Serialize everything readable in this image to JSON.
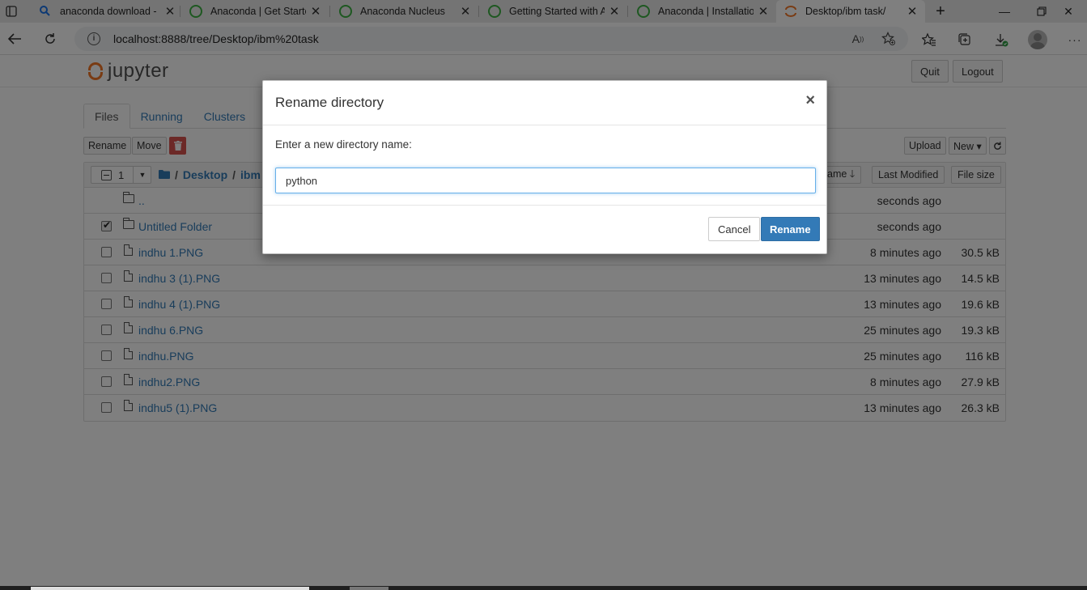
{
  "browser": {
    "tabs": [
      {
        "title": "anaconda download -",
        "icon": "search-icon"
      },
      {
        "title": "Anaconda | Get Started",
        "icon": "loading-ring-icon"
      },
      {
        "title": "Anaconda Nucleus",
        "icon": "loading-ring-icon"
      },
      {
        "title": "Getting Started with A",
        "icon": "loading-ring-icon"
      },
      {
        "title": "Anaconda | Installation",
        "icon": "loading-ring-icon"
      },
      {
        "title": "Desktop/ibm task/",
        "icon": "jupyter-icon",
        "active": true
      }
    ],
    "url": "localhost:8888/tree/Desktop/ibm%20task"
  },
  "jupyter": {
    "logo_text": "jupyter",
    "quit_label": "Quit",
    "logout_label": "Logout",
    "tabs": [
      "Files",
      "Running",
      "Clusters"
    ],
    "toolbar": {
      "rename_label": "Rename",
      "move_label": "Move",
      "upload_label": "Upload",
      "new_label": "New ▾"
    },
    "list_header": {
      "selected_count": "1",
      "breadcrumb_root": "/",
      "breadcrumb_desktop": "Desktop",
      "breadcrumb_current": "ibm t",
      "name_sort_label": "ame 🡓",
      "last_modified_label": "Last Modified",
      "file_size_label": "File size"
    },
    "items": [
      {
        "name": "..",
        "type": "folder",
        "modified": "seconds ago",
        "size": "",
        "checked": false,
        "no_checkbox": true
      },
      {
        "name": "Untitled Folder",
        "type": "folder",
        "modified": "seconds ago",
        "size": "",
        "checked": true
      },
      {
        "name": "indhu 1.PNG",
        "type": "file",
        "modified": "8 minutes ago",
        "size": "30.5 kB",
        "checked": false
      },
      {
        "name": "indhu 3 (1).PNG",
        "type": "file",
        "modified": "13 minutes ago",
        "size": "14.5 kB",
        "checked": false
      },
      {
        "name": "indhu 4 (1).PNG",
        "type": "file",
        "modified": "13 minutes ago",
        "size": "19.6 kB",
        "checked": false
      },
      {
        "name": "indhu 6.PNG",
        "type": "file",
        "modified": "25 minutes ago",
        "size": "19.3 kB",
        "checked": false
      },
      {
        "name": "indhu.PNG",
        "type": "file",
        "modified": "25 minutes ago",
        "size": "116 kB",
        "checked": false
      },
      {
        "name": "indhu2.PNG",
        "type": "file",
        "modified": "8 minutes ago",
        "size": "27.9 kB",
        "checked": false
      },
      {
        "name": "indhu5 (1).PNG",
        "type": "file",
        "modified": "13 minutes ago",
        "size": "26.3 kB",
        "checked": false
      }
    ]
  },
  "modal": {
    "title": "Rename directory",
    "close_label": "×",
    "label": "Enter a new directory name:",
    "input_value": "python",
    "cancel_label": "Cancel",
    "rename_label": "Rename"
  },
  "colors": {
    "accent": "#337ab7",
    "danger": "#d9534f",
    "jupyter_orange": "#f37726",
    "loading_green": "#3cb043"
  }
}
